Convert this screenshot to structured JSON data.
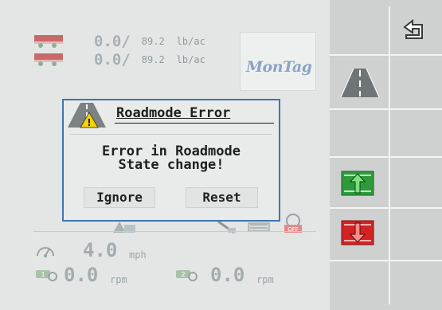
{
  "rates": [
    {
      "value": "0.0/",
      "target": "89.2",
      "unit": "lb/ac"
    },
    {
      "value": "0.0/",
      "target": "89.2",
      "unit": "lb/ac"
    }
  ],
  "brand": {
    "logo_text": "MonTag",
    "color": "#8aa3c6"
  },
  "dialog": {
    "title": "Roadmode Error",
    "message_line1": "Error in Roadmode",
    "message_line2": "State change!",
    "ignore_label": "Ignore",
    "reset_label": "Reset",
    "border_color": "#3d74b0"
  },
  "speed": {
    "value": "4.0",
    "unit": "mph"
  },
  "shaft1": {
    "value": "0.0",
    "unit": "rpm"
  },
  "shaft2": {
    "value": "0.0",
    "unit": "rpm"
  },
  "sidebar": {
    "buttons": [
      {
        "name": "back",
        "icon": "return-arrow-icon"
      },
      {
        "name": "roadmode",
        "icon": "road-icon"
      },
      {
        "name": "raise",
        "icon": "raise-arrow-icon",
        "color": "#2e9b3a"
      },
      {
        "name": "lower",
        "icon": "lower-arrow-icon",
        "color": "#d32323"
      }
    ]
  },
  "status_icons": [
    {
      "name": "off-indicator",
      "text": "OFF"
    }
  ]
}
